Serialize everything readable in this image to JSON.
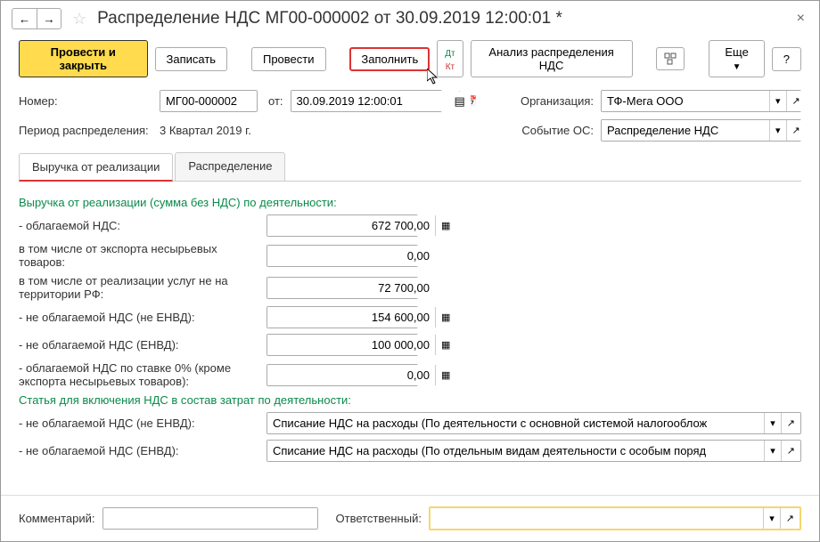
{
  "title": "Распределение НДС МГ00-000002 от 30.09.2019 12:00:01 *",
  "toolbar": {
    "primary": "Провести и закрыть",
    "write": "Записать",
    "post": "Провести",
    "fill": "Заполнить",
    "analysis": "Анализ распределения НДС",
    "more": "Еще",
    "help": "?"
  },
  "header": {
    "number_label": "Номер:",
    "number": "МГ00-000002",
    "date_label": "от:",
    "date": "30.09.2019 12:00:01",
    "org_label": "Организация:",
    "org": "ТФ-Мега ООО",
    "period_label": "Период распределения:",
    "period": "3 Квартал 2019  г.",
    "event_label": "Событие ОС:",
    "event": "Распределение НДС"
  },
  "tabs": {
    "revenue": "Выручка от реализации",
    "distribution": "Распределение"
  },
  "content": {
    "section1": "Выручка от реализации (сумма без НДС) по деятельности:",
    "vat_taxable_label": "- облагаемой НДС:",
    "vat_taxable": "672 700,00",
    "export_label": "в том числе от экспорта несырьевых товаров:",
    "export": "0,00",
    "services_label": "в том числе от реализации услуг не на территории РФ:",
    "services": "72 700,00",
    "not_vat_label": "- не облагаемой НДС (не ЕНВД):",
    "not_vat": "154 600,00",
    "envd_label": "- не облагаемой НДС (ЕНВД):",
    "envd": "100 000,00",
    "zero_label": "- облагаемой НДС по ставке 0% (кроме экспорта несырьевых товаров):",
    "zero": "0,00",
    "section2": "Статья для включения НДС в состав затрат по деятельности:",
    "article1_label": "- не облагаемой НДС (не ЕНВД):",
    "article1": "Списание НДС на расходы (По деятельности с основной системой налогооблож",
    "article2_label": "- не облагаемой НДС (ЕНВД):",
    "article2": "Списание НДС на расходы (По отдельным видам деятельности с особым поряд"
  },
  "footer": {
    "comment_label": "Комментарий:",
    "comment": "",
    "responsible_label": "Ответственный:",
    "responsible": ""
  }
}
